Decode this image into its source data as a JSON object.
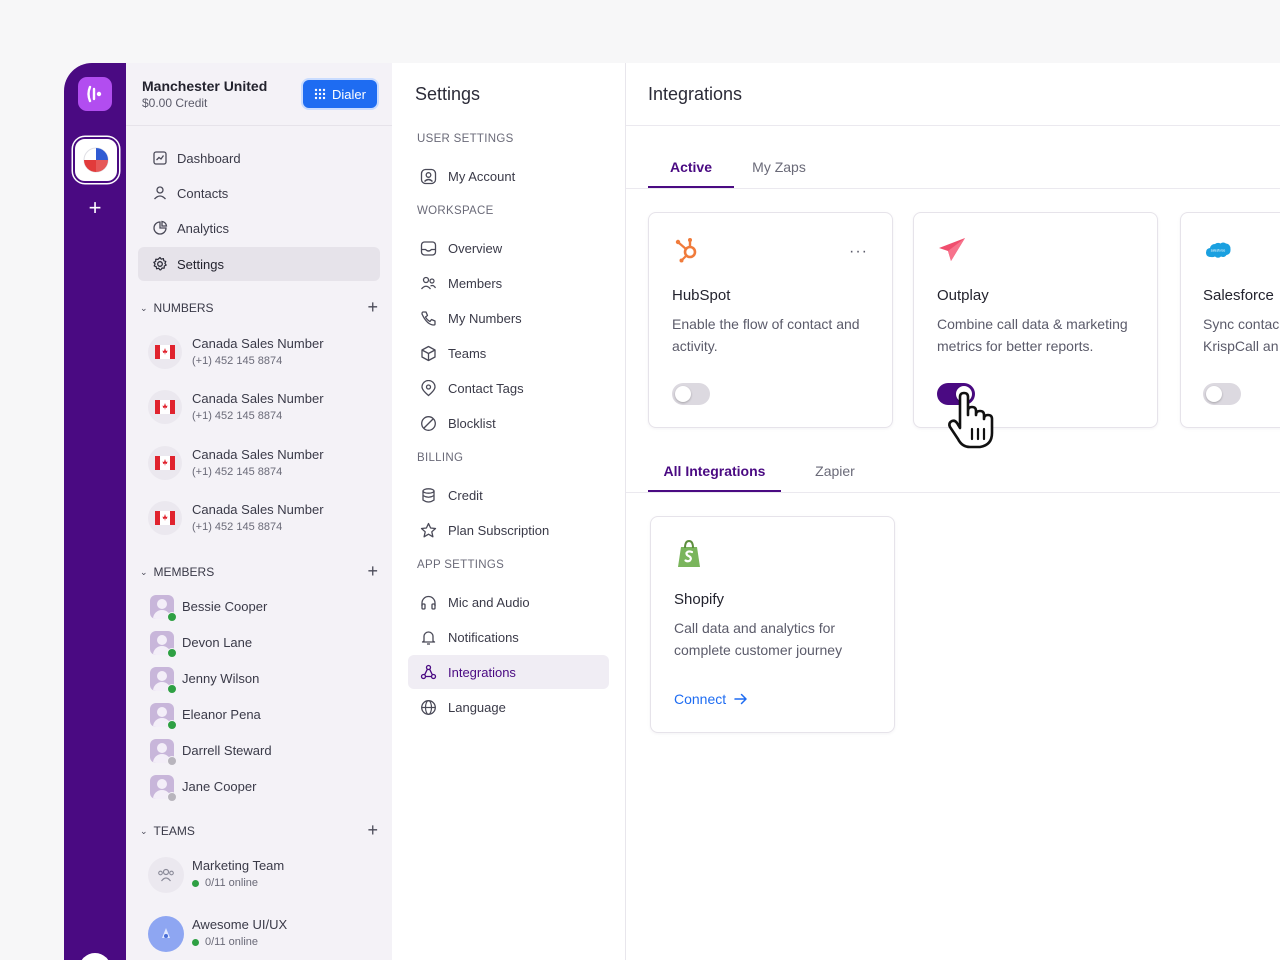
{
  "workspace": {
    "name": "Manchester United",
    "credit": "$0.00 Credit",
    "dialer_label": "Dialer"
  },
  "nav": {
    "items": [
      {
        "label": "Dashboard",
        "icon": "dashboard-icon"
      },
      {
        "label": "Contacts",
        "icon": "contacts-icon"
      },
      {
        "label": "Analytics",
        "icon": "analytics-icon"
      },
      {
        "label": "Settings",
        "icon": "gear-icon",
        "active": true
      }
    ],
    "numbers_heading": "NUMBERS",
    "numbers": [
      {
        "name": "Canada Sales Number",
        "phone": "(+1) 452 145 8874"
      },
      {
        "name": "Canada Sales Number",
        "phone": "(+1) 452 145 8874"
      },
      {
        "name": "Canada Sales Number",
        "phone": "(+1) 452 145 8874"
      },
      {
        "name": "Canada Sales Number",
        "phone": "(+1) 452 145 8874"
      }
    ],
    "members_heading": "MEMBERS",
    "members": [
      {
        "name": "Bessie Cooper",
        "status": "online"
      },
      {
        "name": "Devon Lane",
        "status": "online"
      },
      {
        "name": "Jenny Wilson",
        "status": "online"
      },
      {
        "name": "Eleanor Pena",
        "status": "online"
      },
      {
        "name": "Darrell Steward",
        "status": "offline"
      },
      {
        "name": "Jane Cooper",
        "status": "offline"
      }
    ],
    "teams_heading": "TEAMS",
    "teams": [
      {
        "name": "Marketing Team",
        "online": "0/11 online"
      },
      {
        "name": "Awesome UI/UX",
        "online": "0/11 online"
      }
    ]
  },
  "settings": {
    "title": "Settings",
    "user_heading": "USER SETTINGS",
    "user_items": [
      "My Account"
    ],
    "workspace_heading": "WORKSPACE",
    "workspace_items": [
      "Overview",
      "Members",
      "My Numbers",
      "Teams",
      "Contact Tags",
      "Blocklist"
    ],
    "billing_heading": "BILLING",
    "billing_items": [
      "Credit",
      "Plan Subscription"
    ],
    "app_heading": "APP SETTINGS",
    "app_items": [
      "Mic and Audio",
      "Notifications",
      "Integrations",
      "Language"
    ],
    "active_item": "Integrations"
  },
  "main": {
    "title": "Integrations",
    "top_tabs": [
      {
        "label": "Active",
        "active": true
      },
      {
        "label": "My Zaps",
        "active": false
      }
    ],
    "active_cards": [
      {
        "name": "HubSpot",
        "desc": "Enable the flow of contact and activity.",
        "enabled": false,
        "more": "···"
      },
      {
        "name": "Outplay",
        "desc": "Combine call data & marketing metrics for better reports.",
        "enabled": true
      },
      {
        "name": "Salesforce",
        "desc": "Sync contac KrispCall an",
        "enabled": false
      }
    ],
    "bottom_tabs": [
      {
        "label": "All Integrations",
        "active": true
      },
      {
        "label": "Zapier",
        "active": false
      }
    ],
    "all_cards": [
      {
        "name": "Shopify",
        "desc": "Call data and analytics for complete customer journey",
        "action": "Connect"
      }
    ]
  },
  "colors": {
    "brand": "#4a0a82",
    "accent_blue": "#1e6cf2",
    "online": "#2ea043",
    "offline": "#b8b5bd"
  }
}
